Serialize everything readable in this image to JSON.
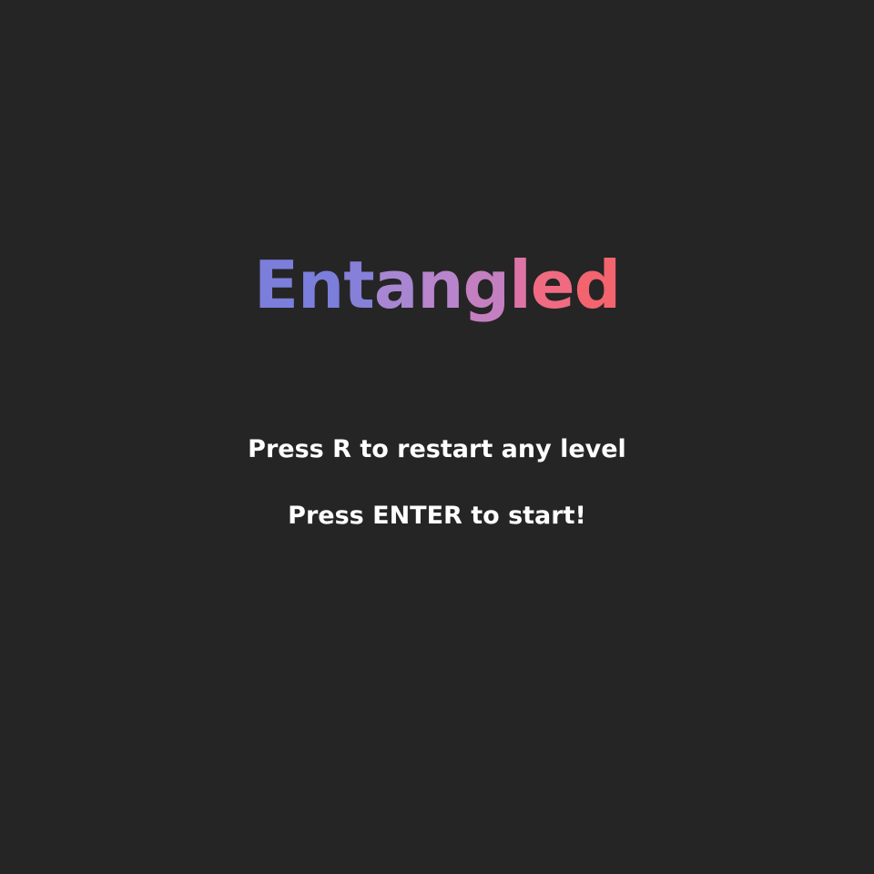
{
  "game": {
    "title": "Entangled",
    "title_letters": [
      {
        "char": "E",
        "color": "#7b7fdb"
      },
      {
        "char": "n",
        "color": "#7c7edb"
      },
      {
        "char": "t",
        "color": "#8780d9"
      },
      {
        "char": "a",
        "color": "#a886d1"
      },
      {
        "char": "n",
        "color": "#b884cc"
      },
      {
        "char": "g",
        "color": "#c47fc0"
      },
      {
        "char": "l",
        "color": "#de74a5"
      },
      {
        "char": "e",
        "color": "#f06b82"
      },
      {
        "char": "d",
        "color": "#f3646f"
      }
    ],
    "instructions": {
      "restart": "Press R to restart any level",
      "start": "Press ENTER to start!"
    }
  }
}
